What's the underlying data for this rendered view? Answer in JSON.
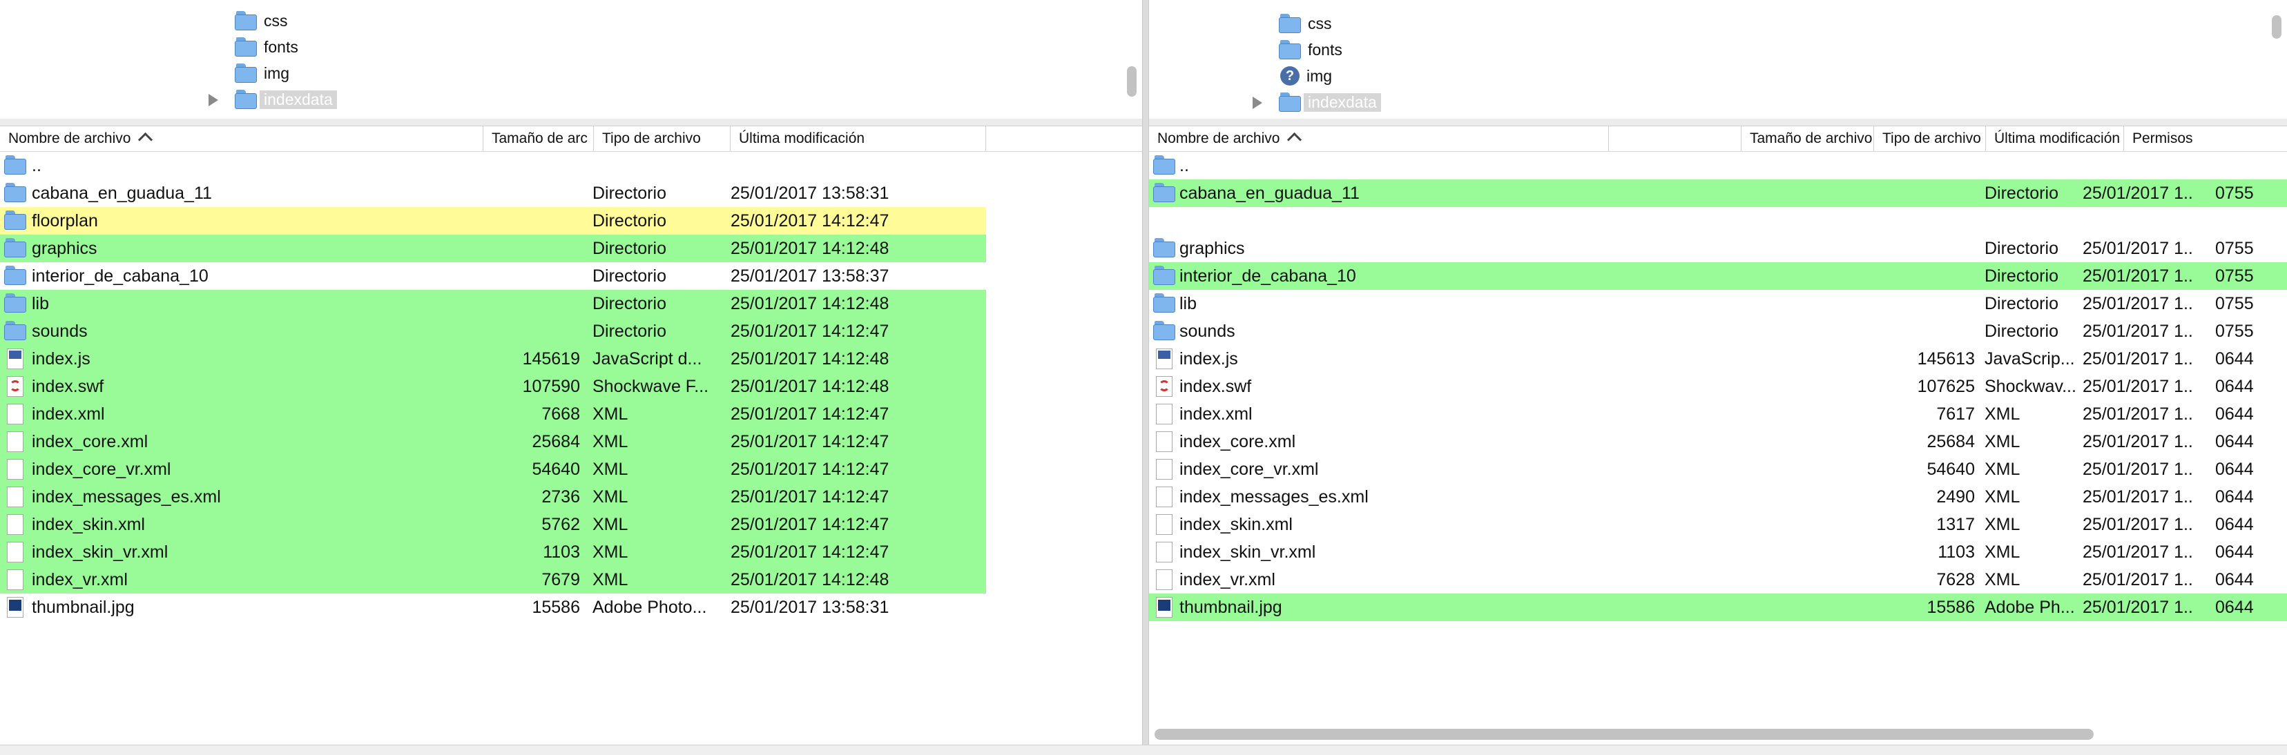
{
  "left": {
    "tree": [
      {
        "label": "css",
        "type": "folder"
      },
      {
        "label": "fonts",
        "type": "folder"
      },
      {
        "label": "img",
        "type": "folder"
      },
      {
        "label": "indexdata",
        "type": "folder",
        "selected": true,
        "collapsed": true
      }
    ],
    "columns": {
      "name": "Nombre de archivo",
      "size": "Tamaño de arc",
      "type": "Tipo de archivo",
      "modified": "Última modificación"
    },
    "files": [
      {
        "name": "..",
        "icon": "folder",
        "size": "",
        "type": "",
        "modified": "",
        "highlight": "none"
      },
      {
        "name": "cabana_en_guadua_11",
        "icon": "folder",
        "size": "",
        "type": "Directorio",
        "modified": "25/01/2017 13:58:31",
        "highlight": "none"
      },
      {
        "name": "floorplan",
        "icon": "folder",
        "size": "",
        "type": "Directorio",
        "modified": "25/01/2017 14:12:47",
        "highlight": "yellow"
      },
      {
        "name": "graphics",
        "icon": "folder",
        "size": "",
        "type": "Directorio",
        "modified": "25/01/2017 14:12:48",
        "highlight": "green"
      },
      {
        "name": "interior_de_cabana_10",
        "icon": "folder",
        "size": "",
        "type": "Directorio",
        "modified": "25/01/2017 13:58:37",
        "highlight": "none"
      },
      {
        "name": "lib",
        "icon": "folder",
        "size": "",
        "type": "Directorio",
        "modified": "25/01/2017 14:12:48",
        "highlight": "green"
      },
      {
        "name": "sounds",
        "icon": "folder",
        "size": "",
        "type": "Directorio",
        "modified": "25/01/2017 14:12:47",
        "highlight": "green"
      },
      {
        "name": "index.js",
        "icon": "js",
        "size": "145619",
        "type": "JavaScript d...",
        "modified": "25/01/2017 14:12:48",
        "highlight": "green"
      },
      {
        "name": "index.swf",
        "icon": "swf",
        "size": "107590",
        "type": "Shockwave F...",
        "modified": "25/01/2017 14:12:48",
        "highlight": "green"
      },
      {
        "name": "index.xml",
        "icon": "doc",
        "size": "7668",
        "type": "XML",
        "modified": "25/01/2017 14:12:47",
        "highlight": "green"
      },
      {
        "name": "index_core.xml",
        "icon": "doc",
        "size": "25684",
        "type": "XML",
        "modified": "25/01/2017 14:12:47",
        "highlight": "green"
      },
      {
        "name": "index_core_vr.xml",
        "icon": "doc",
        "size": "54640",
        "type": "XML",
        "modified": "25/01/2017 14:12:47",
        "highlight": "green"
      },
      {
        "name": "index_messages_es.xml",
        "icon": "doc",
        "size": "2736",
        "type": "XML",
        "modified": "25/01/2017 14:12:47",
        "highlight": "green"
      },
      {
        "name": "index_skin.xml",
        "icon": "doc",
        "size": "5762",
        "type": "XML",
        "modified": "25/01/2017 14:12:47",
        "highlight": "green"
      },
      {
        "name": "index_skin_vr.xml",
        "icon": "doc",
        "size": "1103",
        "type": "XML",
        "modified": "25/01/2017 14:12:47",
        "highlight": "green"
      },
      {
        "name": "index_vr.xml",
        "icon": "doc",
        "size": "7679",
        "type": "XML",
        "modified": "25/01/2017 14:12:48",
        "highlight": "green"
      },
      {
        "name": "thumbnail.jpg",
        "icon": "jpg",
        "size": "15586",
        "type": "Adobe Photo...",
        "modified": "25/01/2017 13:58:31",
        "highlight": "none"
      }
    ]
  },
  "right": {
    "tree": [
      {
        "label": "css",
        "type": "folder"
      },
      {
        "label": "fonts",
        "type": "folder"
      },
      {
        "label": "img",
        "type": "unknown"
      },
      {
        "label": "indexdata",
        "type": "folder",
        "selected": true,
        "collapsed": true
      }
    ],
    "columns": {
      "name": "Nombre de archivo",
      "size": "Tamaño de archivo",
      "type": "Tipo de archivo",
      "modified": "Última modificación",
      "perms": "Permisos"
    },
    "files": [
      {
        "name": "..",
        "icon": "folder",
        "size": "",
        "type": "",
        "modified": "",
        "perms": "",
        "highlight": "none"
      },
      {
        "name": "cabana_en_guadua_11",
        "icon": "folder",
        "size": "",
        "type": "Directorio",
        "modified": "25/01/2017 1...",
        "perms": "0755",
        "highlight": "green"
      },
      {
        "name": "",
        "icon": "none",
        "size": "",
        "type": "",
        "modified": "",
        "perms": "",
        "highlight": "none"
      },
      {
        "name": "graphics",
        "icon": "folder",
        "size": "",
        "type": "Directorio",
        "modified": "25/01/2017 1...",
        "perms": "0755",
        "highlight": "none"
      },
      {
        "name": "interior_de_cabana_10",
        "icon": "folder",
        "size": "",
        "type": "Directorio",
        "modified": "25/01/2017 1...",
        "perms": "0755",
        "highlight": "green"
      },
      {
        "name": "lib",
        "icon": "folder",
        "size": "",
        "type": "Directorio",
        "modified": "25/01/2017 1...",
        "perms": "0755",
        "highlight": "none"
      },
      {
        "name": "sounds",
        "icon": "folder",
        "size": "",
        "type": "Directorio",
        "modified": "25/01/2017 1...",
        "perms": "0755",
        "highlight": "none"
      },
      {
        "name": "index.js",
        "icon": "js",
        "size": "145613",
        "type": "JavaScrip...",
        "modified": "25/01/2017 1...",
        "perms": "0644",
        "highlight": "none"
      },
      {
        "name": "index.swf",
        "icon": "swf",
        "size": "107625",
        "type": "Shockwav...",
        "modified": "25/01/2017 1...",
        "perms": "0644",
        "highlight": "none"
      },
      {
        "name": "index.xml",
        "icon": "doc",
        "size": "7617",
        "type": "XML",
        "modified": "25/01/2017 1...",
        "perms": "0644",
        "highlight": "none"
      },
      {
        "name": "index_core.xml",
        "icon": "doc",
        "size": "25684",
        "type": "XML",
        "modified": "25/01/2017 1...",
        "perms": "0644",
        "highlight": "none"
      },
      {
        "name": "index_core_vr.xml",
        "icon": "doc",
        "size": "54640",
        "type": "XML",
        "modified": "25/01/2017 1...",
        "perms": "0644",
        "highlight": "none"
      },
      {
        "name": "index_messages_es.xml",
        "icon": "doc",
        "size": "2490",
        "type": "XML",
        "modified": "25/01/2017 1...",
        "perms": "0644",
        "highlight": "none"
      },
      {
        "name": "index_skin.xml",
        "icon": "doc",
        "size": "1317",
        "type": "XML",
        "modified": "25/01/2017 1...",
        "perms": "0644",
        "highlight": "none"
      },
      {
        "name": "index_skin_vr.xml",
        "icon": "doc",
        "size": "1103",
        "type": "XML",
        "modified": "25/01/2017 1...",
        "perms": "0644",
        "highlight": "none"
      },
      {
        "name": "index_vr.xml",
        "icon": "doc",
        "size": "7628",
        "type": "XML",
        "modified": "25/01/2017 1...",
        "perms": "0644",
        "highlight": "none"
      },
      {
        "name": "thumbnail.jpg",
        "icon": "jpg",
        "size": "15586",
        "type": "Adobe Ph...",
        "modified": "25/01/2017 1...",
        "perms": "0644",
        "highlight": "green"
      }
    ]
  },
  "colors": {
    "green": "#98fb98",
    "yellow": "#fffb98",
    "folder": "#7fb6ee"
  }
}
